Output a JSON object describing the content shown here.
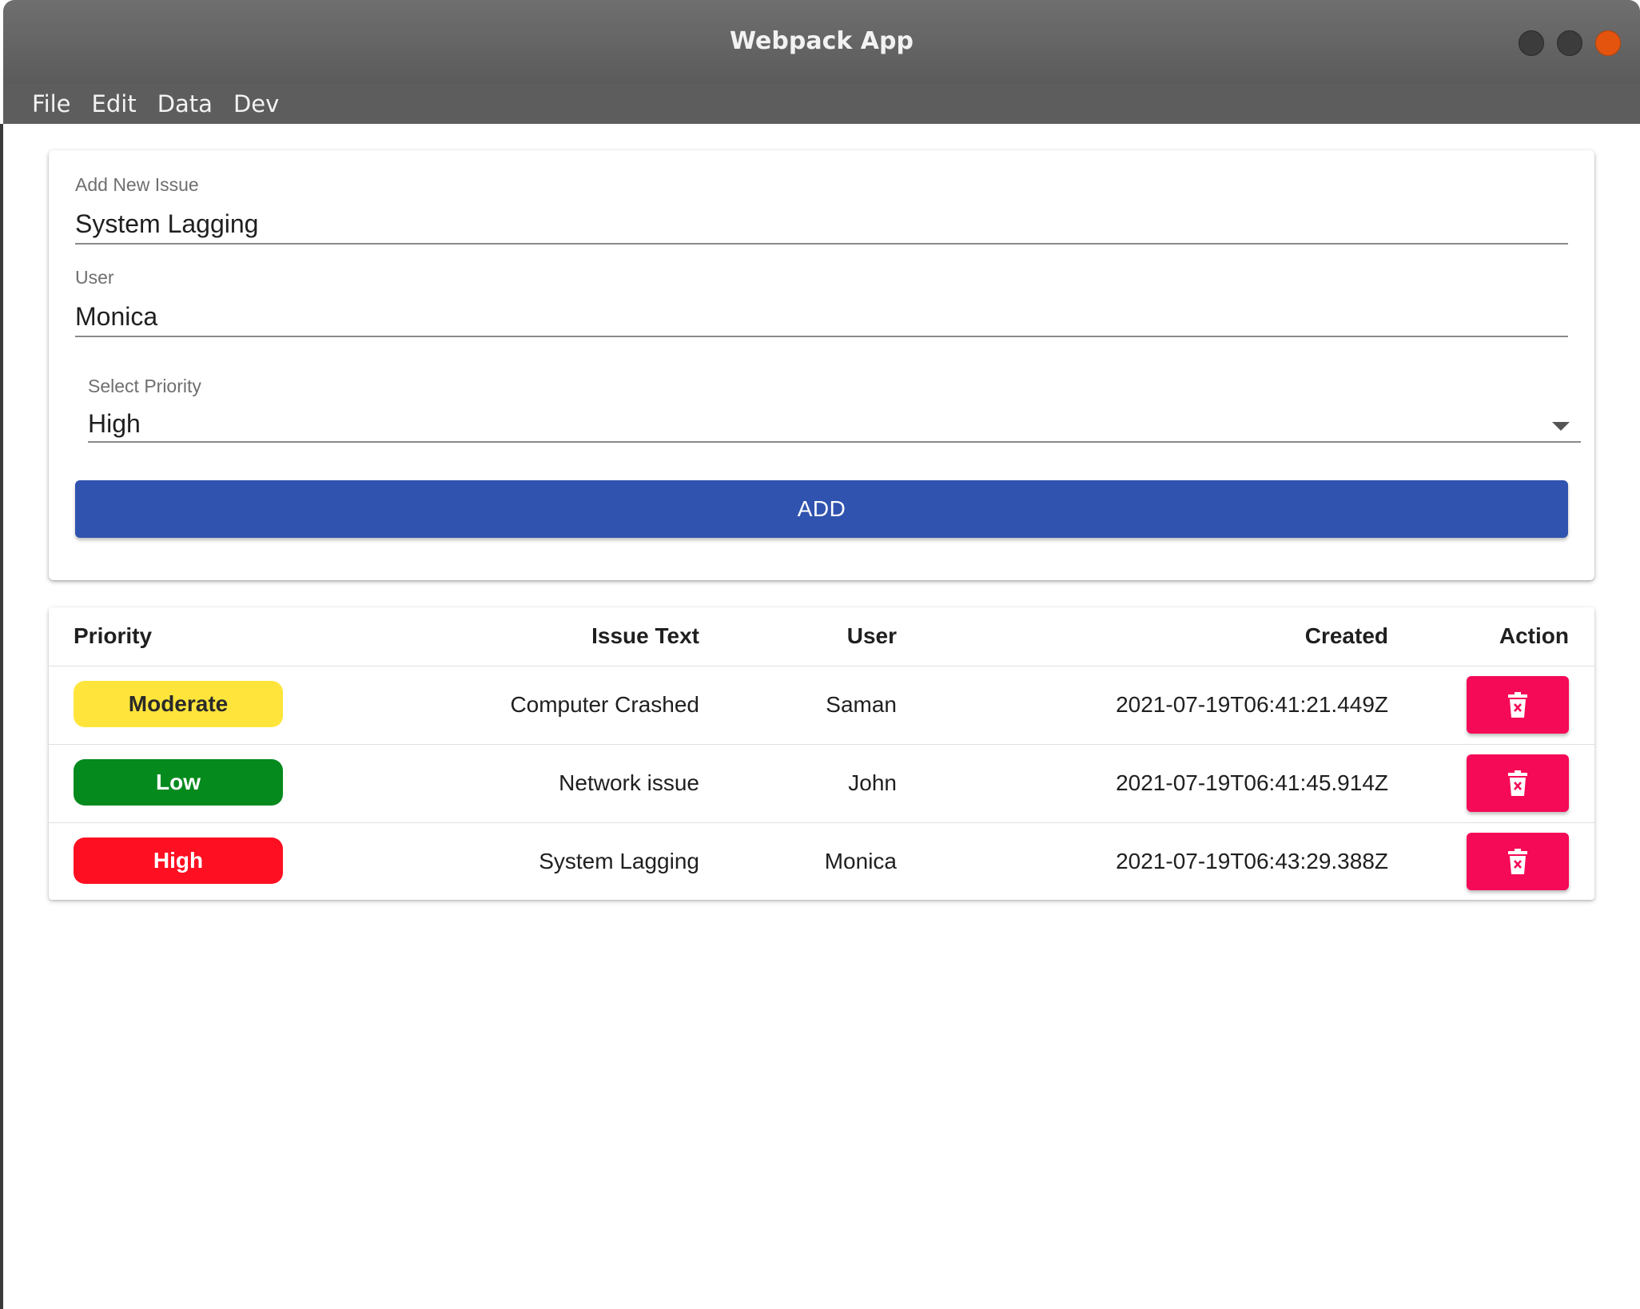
{
  "window": {
    "title": "Webpack App"
  },
  "menu": {
    "items": [
      "File",
      "Edit",
      "Data",
      "Dev"
    ]
  },
  "form": {
    "issue_label": "Add New Issue",
    "issue_value": "System Lagging",
    "user_label": "User",
    "user_value": "Monica",
    "priority_label": "Select Priority",
    "priority_value": "High",
    "add_label": "ADD"
  },
  "table": {
    "headers": {
      "priority": "Priority",
      "issue": "Issue Text",
      "user": "User",
      "created": "Created",
      "action": "Action"
    },
    "rows": [
      {
        "priority": "Moderate",
        "issue": "Computer Crashed",
        "user": "Saman",
        "created": "2021-07-19T06:41:21.449Z",
        "action_icon": "trash-icon"
      },
      {
        "priority": "Low",
        "issue": "Network issue",
        "user": "John",
        "created": "2021-07-19T06:41:45.914Z",
        "action_icon": "trash-icon"
      },
      {
        "priority": "High",
        "issue": "System Lagging",
        "user": "Monica",
        "created": "2021-07-19T06:43:29.388Z",
        "action_icon": "trash-icon"
      }
    ]
  },
  "colors": {
    "add_button": "#3053af",
    "delete_button": "#f50a57",
    "moderate": "#ffe53b",
    "low": "#058a1e",
    "high": "#ff0f22"
  }
}
